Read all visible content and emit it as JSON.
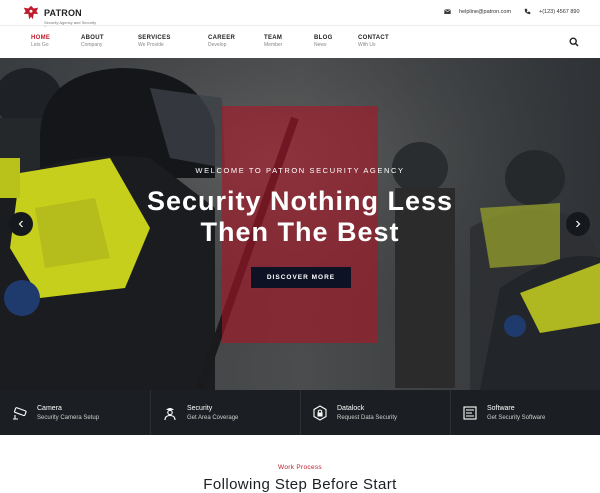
{
  "brand": {
    "name": "PATRON",
    "tagline": "Security Agency and Security Service"
  },
  "contact": {
    "email": "helpline@patron.com",
    "phone": "+(123) 4567 890"
  },
  "nav": [
    {
      "label": "HOME",
      "sub": "Lets Go"
    },
    {
      "label": "ABOUT",
      "sub": "Company"
    },
    {
      "label": "SERVICES",
      "sub": "We Provide"
    },
    {
      "label": "CAREER",
      "sub": "Develop"
    },
    {
      "label": "TEAM",
      "sub": "Member"
    },
    {
      "label": "BLOG",
      "sub": "News"
    },
    {
      "label": "CONTACT",
      "sub": "With Us"
    }
  ],
  "hero": {
    "welcome": "WELCOME TO PATRON SECURITY AGENCY",
    "title_line1": "Security Nothing Less",
    "title_line2": "Then The Best",
    "cta": "DISCOVER MORE"
  },
  "features": [
    {
      "title": "Camera",
      "sub": "Security Camera Setup",
      "icon": "cctv-camera-icon"
    },
    {
      "title": "Security",
      "sub": "Get Area Coverage",
      "icon": "security-guard-icon"
    },
    {
      "title": "Datalock",
      "sub": "Request Data Security",
      "icon": "data-lock-icon"
    },
    {
      "title": "Software",
      "sub": "Get Security Software",
      "icon": "software-icon"
    }
  ],
  "section": {
    "label": "Work Process",
    "title": "Following Step Before Start"
  },
  "colors": {
    "accent": "#c01a2a",
    "dark": "#1b1e22",
    "cta": "#0d1324"
  }
}
